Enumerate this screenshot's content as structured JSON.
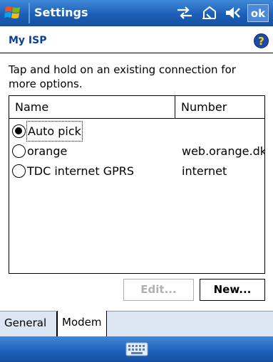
{
  "titlebar": {
    "title": "Settings",
    "ok_label": "ok",
    "icons": [
      "windows-start-icon",
      "connectivity-icon",
      "signal-off-icon",
      "volume-icon"
    ]
  },
  "page": {
    "title": "My ISP",
    "help_glyph": "?",
    "instructions": "Tap and hold on an existing connection for more options."
  },
  "list": {
    "columns": [
      "Name",
      "Number"
    ],
    "rows": [
      {
        "name": "Auto pick",
        "number": "",
        "selected": true
      },
      {
        "name": "orange",
        "number": "web.orange.dk",
        "selected": false
      },
      {
        "name": "TDC internet GPRS",
        "number": "internet",
        "selected": false
      }
    ]
  },
  "buttons": {
    "edit_label": "Edit...",
    "new_label": "New..."
  },
  "tabs": [
    {
      "label": "General",
      "active": false
    },
    {
      "label": "Modem",
      "active": true
    }
  ],
  "menubar": {
    "icon": "keyboard-icon"
  },
  "colors": {
    "titlebar": "#1d5fb8",
    "page_title": "#0b3f9e",
    "disabled_text": "#b0b0b0"
  }
}
